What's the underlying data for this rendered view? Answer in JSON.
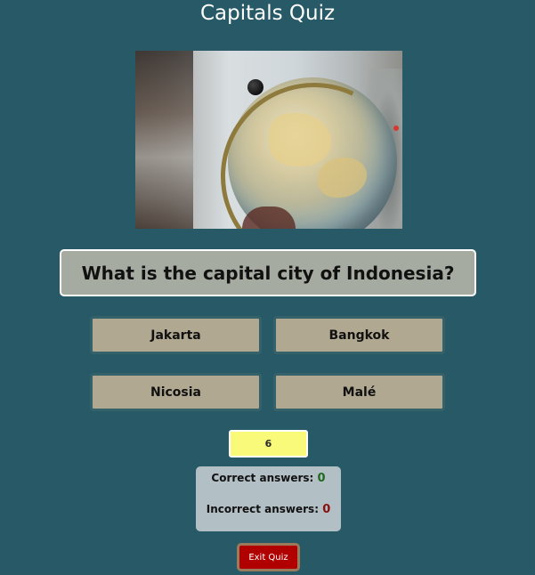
{
  "app": {
    "title": "Capitals Quiz"
  },
  "question": {
    "text": "What is the capital city of Indonesia?"
  },
  "answers": [
    {
      "label": "Jakarta"
    },
    {
      "label": "Bangkok"
    },
    {
      "label": "Nicosia"
    },
    {
      "label": "Malé"
    }
  ],
  "timer": {
    "value": "6"
  },
  "score": {
    "correct_label": "Correct answers:",
    "correct_count": "0",
    "incorrect_label": "Incorrect answers:",
    "incorrect_count": "0"
  },
  "exit_button": {
    "label": "Exit Quiz"
  },
  "colors": {
    "background": "#275a66",
    "question_bg": "#a6aba1",
    "answer_bg": "#b0a891",
    "timer_bg": "#f9f97a",
    "score_bg": "#b2bfc4",
    "exit_bg": "#b00000",
    "correct_count": "#1f6a1f",
    "incorrect_count": "#8a1010"
  }
}
